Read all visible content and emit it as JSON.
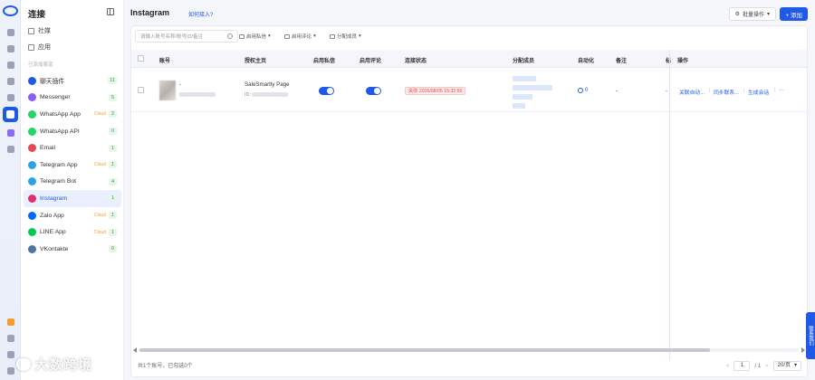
{
  "sidebar": {
    "title": "连接",
    "links": [
      {
        "label": "社媒"
      },
      {
        "label": "应用"
      }
    ],
    "section_label": "已添加渠道",
    "channels": [
      {
        "label": "聊天插件",
        "count": "11",
        "cloud": "",
        "color": "#1f59e8"
      },
      {
        "label": "Messenger",
        "count": "5",
        "cloud": "",
        "color": "#8b5cf6"
      },
      {
        "label": "WhatsApp App",
        "count": "2",
        "cloud": "Cloud",
        "color": "#25d366"
      },
      {
        "label": "WhatsApp API",
        "count": "0",
        "cloud": "",
        "color": "#25d366"
      },
      {
        "label": "Email",
        "count": "1",
        "cloud": "",
        "color": "#e5484d"
      },
      {
        "label": "Telegram App",
        "count": "1",
        "cloud": "Cloud",
        "color": "#2aa3e0"
      },
      {
        "label": "Telegram Bot",
        "count": "4",
        "cloud": "",
        "color": "#2aa3e0"
      },
      {
        "label": "Instagram",
        "count": "1",
        "cloud": "",
        "color": "#e1306c",
        "active": true
      },
      {
        "label": "Zalo App",
        "count": "1",
        "cloud": "Cloud",
        "color": "#0068ff"
      },
      {
        "label": "LINE App",
        "count": "1",
        "cloud": "Cloud",
        "color": "#06c755"
      },
      {
        "label": "VKontakte",
        "count": "0",
        "cloud": "",
        "color": "#4c75a3"
      }
    ]
  },
  "header": {
    "title": "Instagram",
    "help_link": "如何接入?",
    "batch_label": "批量操作",
    "add_label": "+ 添加"
  },
  "filters": {
    "search_placeholder": "请输入账号名称/账号ID/备注",
    "private_msg": "启用私信",
    "comment": "启用评论",
    "assign": "分配成员"
  },
  "table": {
    "columns": {
      "account": "账号",
      "page": "授权主页",
      "private_msg": "启用私信",
      "comment": "启用评论",
      "status": "连接状态",
      "members": "分配成员",
      "auto": "自动化",
      "note": "备注",
      "extra": "标",
      "action": "操作"
    },
    "rows": [
      {
        "account_name": "-",
        "page_name": "SaleSmartly Page",
        "page_id_label": "ID:",
        "status": "失败 2026/08/05 15:32:50",
        "auto_count": "0",
        "note": "-",
        "extra": "-",
        "actions": {
          "relink": "关联自动...",
          "sync": "同步联系...",
          "generate": "生成会话",
          "more": "···"
        }
      }
    ]
  },
  "footer": {
    "summary": "共1个账号，已勾选0个",
    "page_current": "1",
    "page_total": "/ 1",
    "page_size": "20/页"
  },
  "float_tab": "联系我们",
  "watermark": "大数跨境"
}
